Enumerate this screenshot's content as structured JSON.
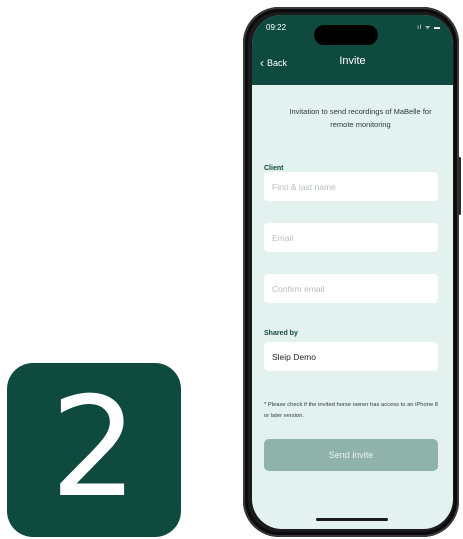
{
  "step": {
    "number": "2"
  },
  "status_bar": {
    "time": "09:22",
    "icons": "ıl ᯤ ▬"
  },
  "nav": {
    "back_label": "Back",
    "title": "Invite"
  },
  "intro_text": "Invitation to send recordings of MaBelle for remote monitoring",
  "client": {
    "label": "Client",
    "name_placeholder": "First & last name",
    "email_placeholder": "Email",
    "confirm_email_placeholder": "Confirm email"
  },
  "shared_by": {
    "label": "Shared by",
    "value": "Sleip Demo"
  },
  "note": "* Please check if the invited horse owner has access to an iPhone 8 or later version.",
  "send_button": {
    "label": "Send invite"
  },
  "colors": {
    "brand_dark": "#0f4a3e",
    "screen_bg": "#e3f2ef",
    "button_disabled": "#8fb3aa"
  }
}
